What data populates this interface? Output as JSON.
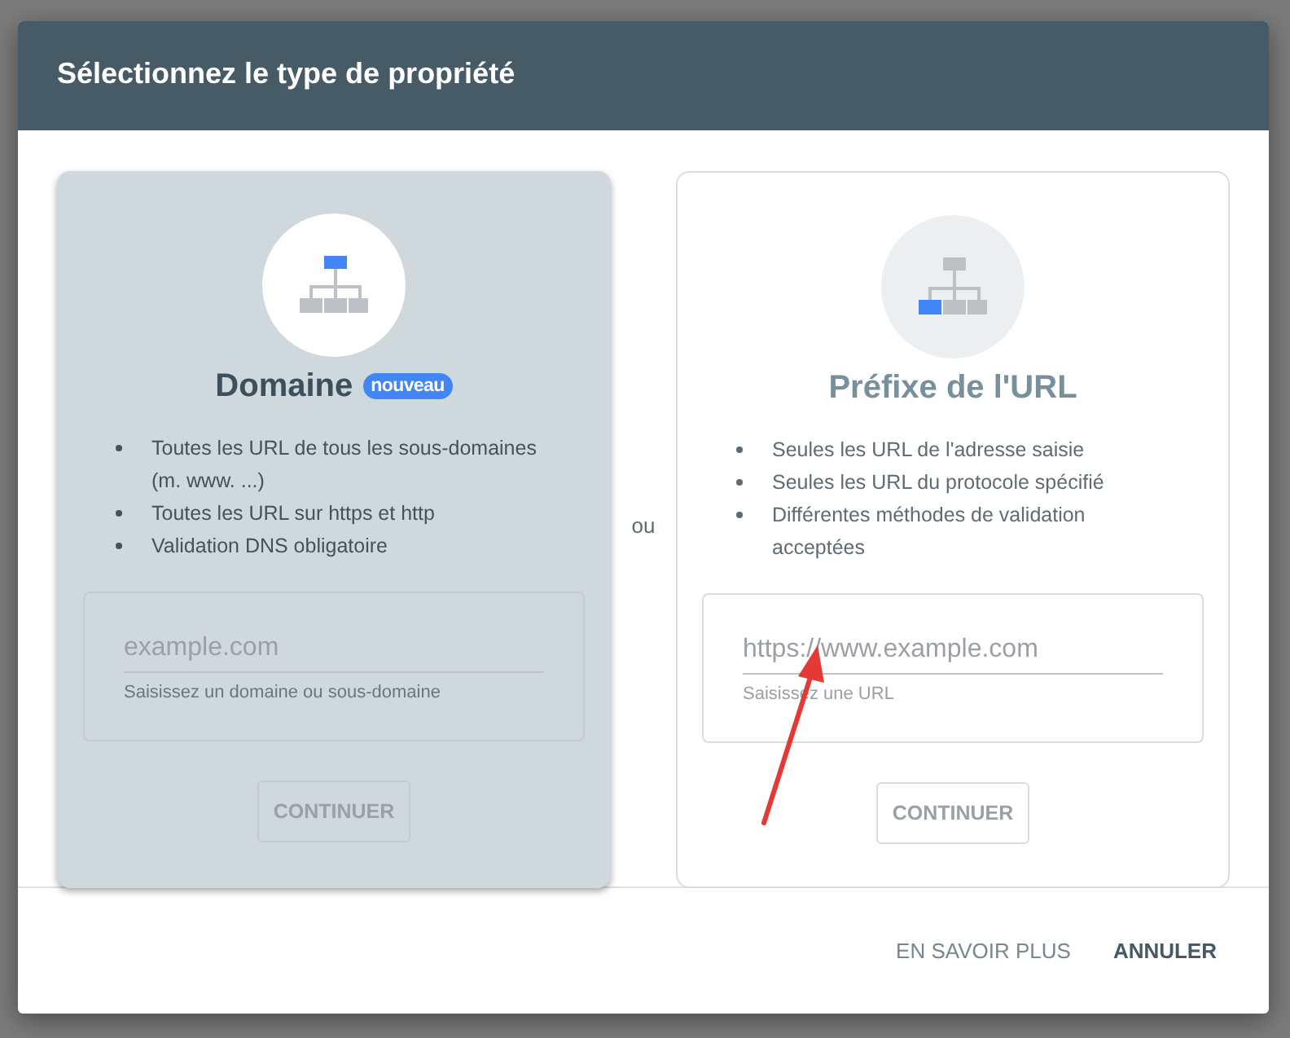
{
  "dialog": {
    "title": "Sélectionnez le type de propriété",
    "cards": [
      {
        "kind": "domain",
        "selected": true,
        "title": "Domaine",
        "badge": "nouveau",
        "bullets": [
          "Toutes les URL de tous les sous-domaines (m. www. ...)",
          "Toutes les URL sur https et http",
          "Validation DNS obligatoire"
        ],
        "placeholder": "example.com",
        "helper": "Saisissez un domaine ou sous-domaine",
        "button": "CONTINUER"
      },
      {
        "kind": "url_prefix",
        "selected": false,
        "title": "Préfixe de l'URL",
        "bullets": [
          "Seules les URL de l'adresse saisie",
          "Seules les URL du protocole spécifié",
          "Différentes méthodes de validation acceptées"
        ],
        "placeholder": "https://www.example.com",
        "helper": "Saisissez une URL",
        "button": "CONTINUER"
      }
    ],
    "separator": "ou",
    "footer_buttons": [
      {
        "label": "EN SAVOIR PLUS",
        "primary": false
      },
      {
        "label": "ANNULER",
        "primary": true
      }
    ]
  }
}
